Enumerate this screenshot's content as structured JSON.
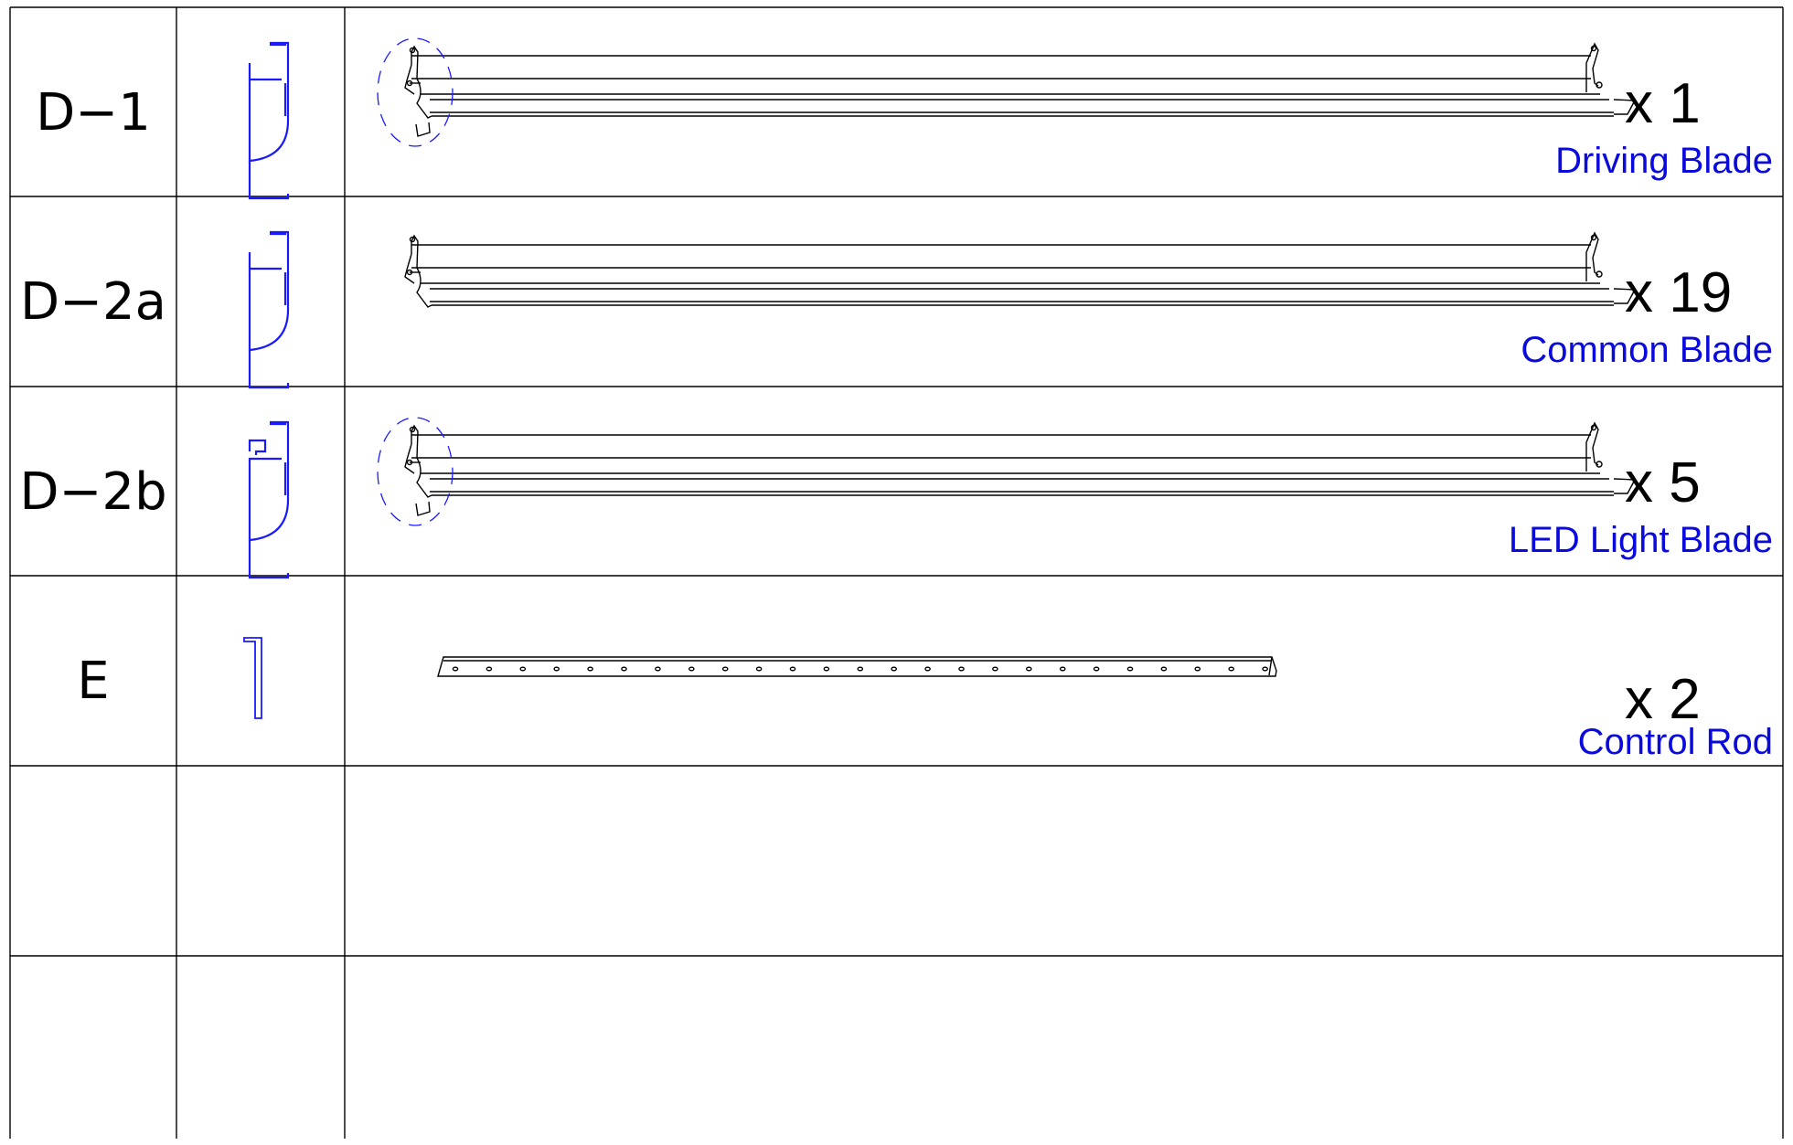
{
  "table": {
    "rows": [
      {
        "code": "D-1",
        "quantity": "x 1",
        "description": "Driving Blade",
        "part": "blade",
        "detail_circle": true
      },
      {
        "code": "D-2a",
        "quantity": "x 19",
        "description": "Common Blade",
        "part": "blade",
        "detail_circle": false
      },
      {
        "code": "D-2b",
        "quantity": "x 5",
        "description": "LED Light Blade",
        "part": "blade",
        "detail_circle": true
      },
      {
        "code": "E",
        "quantity": "x 2",
        "description": "Control Rod",
        "part": "rod",
        "detail_circle": false
      },
      {
        "code": "",
        "quantity": "",
        "description": "",
        "part": "none",
        "detail_circle": false
      },
      {
        "code": "",
        "quantity": "",
        "description": "",
        "part": "none",
        "detail_circle": false
      }
    ]
  },
  "colors": {
    "grid": "#000000",
    "profile": "#1a1aff",
    "description": "#0a0adc",
    "drawing": "#000000"
  },
  "icons": [
    "blade-profile-icon",
    "led-blade-profile-icon",
    "rod-profile-icon",
    "detail-circle-icon"
  ]
}
